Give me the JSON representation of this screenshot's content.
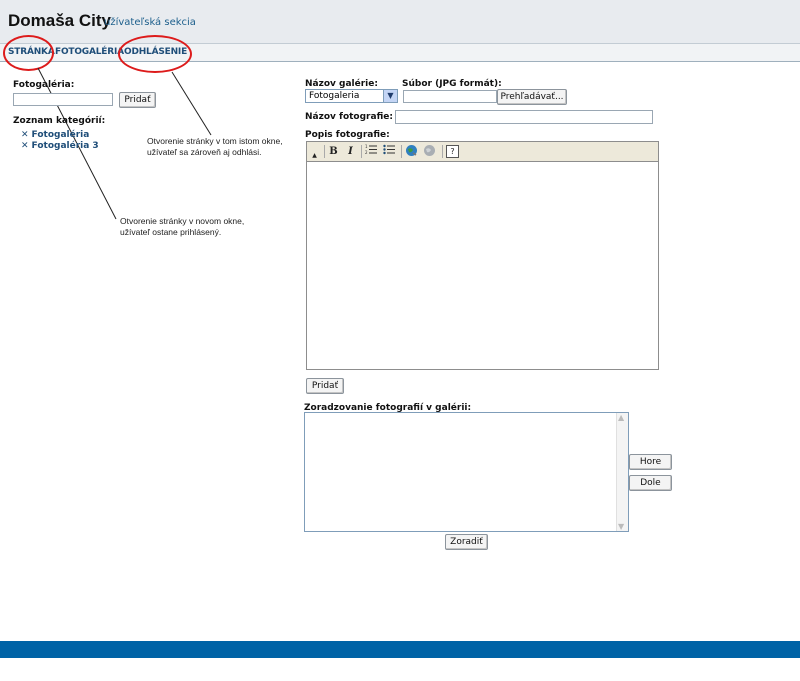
{
  "header": {
    "title": "Domaša City",
    "subtitle": "užívateľská sekcia"
  },
  "nav": {
    "items": [
      "STRÁNKA",
      "FOTOGALÉRIA",
      "ODHLÁSENIE"
    ]
  },
  "left": {
    "gallery_label": "Fotogaléria:",
    "gallery_input_value": "",
    "add_button": "Pridať",
    "categories_label": "Zoznam kategórií:",
    "categories": [
      "Fotogaléria",
      "Fotogaléria 3"
    ],
    "delete_icon": "x-icon"
  },
  "annotations": {
    "note_logout": [
      "Otvorenie stránky v tom istom okne,",
      "užívateľ sa zároveň aj odhlási."
    ],
    "note_newwindow": [
      "Otvorenie stránky v novom okne,",
      "užívateľ ostane prihlásený."
    ],
    "circle_color": "#dd1b1b"
  },
  "form": {
    "gallery_name_label": "Názov galérie:",
    "gallery_select_value": "Fotogaleria",
    "file_label": "Súbor (JPG formát):",
    "file_value": "",
    "browse_button": "Prehľadávať...",
    "photo_name_label": "Názov fotografie:",
    "photo_name_value": "",
    "photo_desc_label": "Popis fotografie:",
    "toolbar": [
      "bold-icon",
      "italic-icon",
      "ordered-list-icon",
      "unordered-list-icon",
      "link-icon",
      "unlink-icon",
      "help-icon"
    ],
    "toolbar_labels": {
      "bold": "B",
      "italic": "I",
      "help": "?"
    },
    "add_button": "Pridať",
    "sort_label": "Zoradzovanie fotografií v galérii:",
    "up_button": "Hore",
    "down_button": "Dole",
    "sort_button": "Zoradiť"
  },
  "colors": {
    "nav_text": "#1f4e79",
    "footer": "#0063a6",
    "header_bg": "#e8ebef"
  }
}
